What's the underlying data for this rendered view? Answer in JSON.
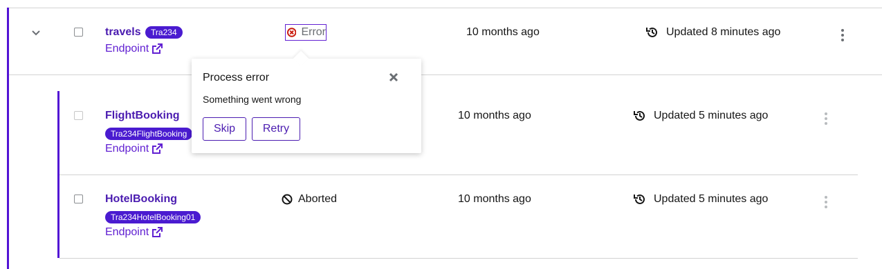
{
  "colors": {
    "accent": "#5213d4",
    "link": "#6120d2",
    "error": "#c9190b",
    "border": "#d2d2d2"
  },
  "rows": [
    {
      "name": "travels",
      "badge": "Tra234",
      "endpoint_label": "Endpoint",
      "status": "Error",
      "status_icon": "error-circle-icon",
      "created": "10 months ago",
      "updated": "Updated 8 minutes ago"
    },
    {
      "name": "FlightBooking",
      "badge": "Tra234FlightBooking",
      "endpoint_label": "Endpoint",
      "created": "10 months ago",
      "updated": "Updated 5 minutes ago"
    },
    {
      "name": "HotelBooking",
      "badge": "Tra234HotelBooking01",
      "endpoint_label": "Endpoint",
      "status": "Aborted",
      "status_icon": "ban-icon",
      "created": "10 months ago",
      "updated": "Updated 5 minutes ago"
    }
  ],
  "popover": {
    "title": "Process error",
    "message": "Something went wrong",
    "skip_label": "Skip",
    "retry_label": "Retry"
  }
}
